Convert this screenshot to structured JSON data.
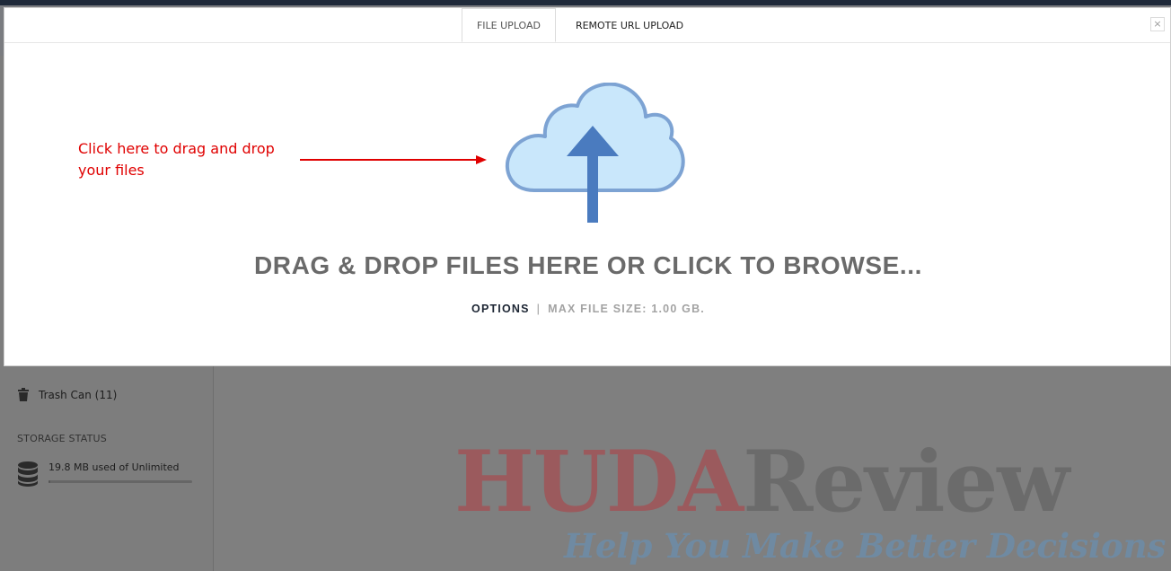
{
  "modal": {
    "tabs": [
      {
        "label": "FILE UPLOAD",
        "active": true
      },
      {
        "label": "REMOTE URL UPLOAD",
        "active": false
      }
    ],
    "close_label": "×",
    "dropzone": {
      "text": "DRAG & DROP FILES HERE OR CLICK TO BROWSE...",
      "icon": "cloud-upload-icon"
    },
    "options_label": "OPTIONS",
    "separator": "|",
    "max_file_size": "MAX FILE SIZE: 1.00 GB."
  },
  "annotation": {
    "line1": "Click here to drag and drop",
    "line2": "your files",
    "color": "#e00000"
  },
  "sidebar": {
    "trash_label": "Trash Can (11)",
    "storage_heading": "STORAGE STATUS",
    "storage_text": "19.8 MB used of Unlimited",
    "storage_used_fraction": 0.01
  },
  "watermark": {
    "part1": "HUDA",
    "part2": "Review",
    "tagline": "Help You Make Better Decisions"
  },
  "colors": {
    "overlay": "#7f7f7f",
    "cloud_fill": "#c9e7fb",
    "cloud_stroke": "#7da3d3",
    "arrow": "#4a7bbf"
  }
}
